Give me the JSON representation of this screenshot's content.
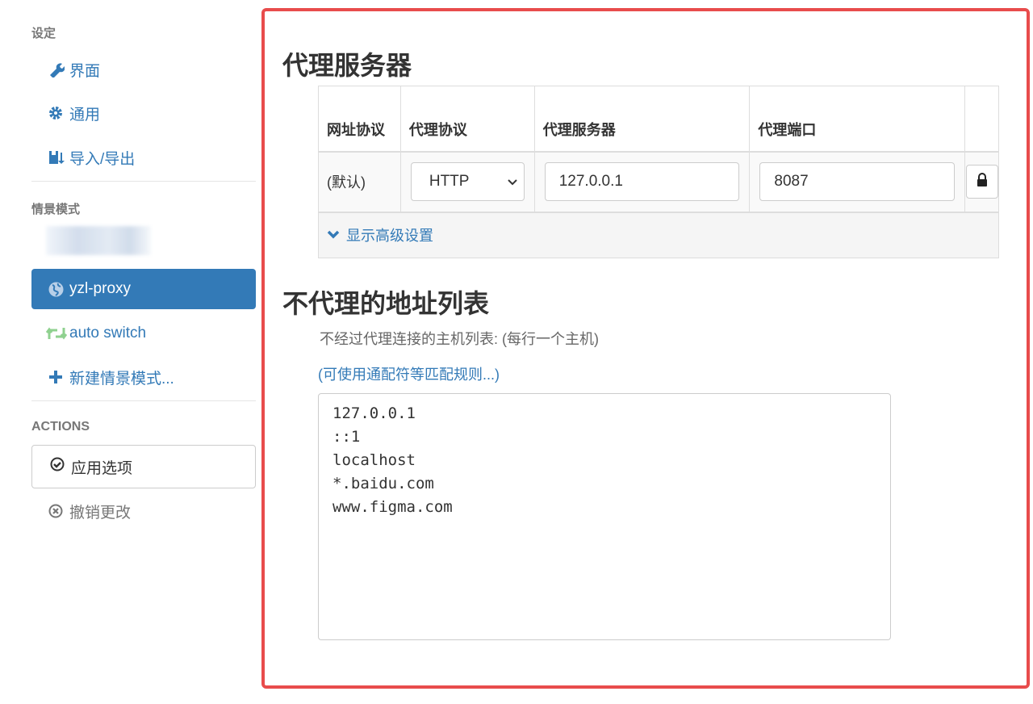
{
  "sidebar": {
    "settings_header": "设定",
    "settings_items": [
      {
        "label": "界面",
        "icon": "wrench-icon"
      },
      {
        "label": "通用",
        "icon": "gear-icon"
      },
      {
        "label": "导入/导出",
        "icon": "import-export-icon"
      }
    ],
    "profiles_header": "情景模式",
    "profiles": [
      {
        "label": "yzl-proxy",
        "icon": "globe-icon",
        "active": true
      },
      {
        "label": "auto switch",
        "icon": "retweet-icon"
      },
      {
        "label": "新建情景模式...",
        "icon": "plus-icon"
      }
    ],
    "actions_header": "ACTIONS",
    "apply_label": "应用选项",
    "discard_label": "撤销更改"
  },
  "main": {
    "proxy_title": "代理服务器",
    "table": {
      "headers": [
        "网址协议",
        "代理协议",
        "代理服务器",
        "代理端口"
      ],
      "row": {
        "scheme": "(默认)",
        "protocol": "HTTP",
        "server": "127.0.0.1",
        "port": "8087"
      },
      "advanced_label": "显示高级设置"
    },
    "bypass_title": "不代理的地址列表",
    "bypass_desc": "不经过代理连接的主机列表: (每行一个主机)",
    "wildcard_link": "(可使用通配符等匹配规则...)",
    "bypass_list": "127.0.0.1\n::1\nlocalhost\n*.baidu.com\nwww.figma.com"
  },
  "colors": {
    "accent": "#337ab7",
    "highlight_border": "#e84c4c",
    "auto_switch_icon": "#8fd18f"
  }
}
